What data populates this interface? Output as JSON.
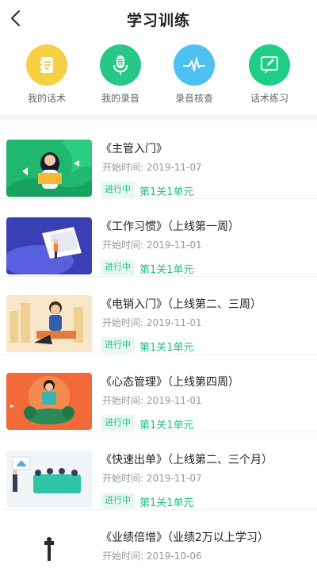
{
  "header": {
    "title": "学习训练"
  },
  "quick_nav": [
    {
      "label": "我的话术",
      "icon": "script-book-icon",
      "color": "#f7cf45"
    },
    {
      "label": "我的录音",
      "icon": "microphone-icon",
      "color": "#27c788"
    },
    {
      "label": "录音核查",
      "icon": "waveform-icon",
      "color": "#4ec1f2"
    },
    {
      "label": "话术练习",
      "icon": "edit-chat-icon",
      "color": "#1fcd85"
    }
  ],
  "courses": [
    {
      "title": "《主管入门》",
      "date": "开始时间: 2019-11-07",
      "status": "进行中",
      "progress": "第1关1单元"
    },
    {
      "title": "《工作习惯》（上线第一周）",
      "date": "开始时间: 2019-11-01",
      "status": "进行中",
      "progress": "第1关1单元"
    },
    {
      "title": "《电销入门》（上线第二、三周）",
      "date": "开始时间: 2019-11-01",
      "status": "进行中",
      "progress": "第1关1单元"
    },
    {
      "title": "《心态管理》（上线第四周）",
      "date": "开始时间: 2019-11-01",
      "status": "进行中",
      "progress": "第1关1单元"
    },
    {
      "title": "《快速出单》（上线第二、三个月）",
      "date": "开始时间: 2019-11-07",
      "status": "进行中",
      "progress": "第1关1单元"
    },
    {
      "title": "《业绩倍增》（业绩2万以上学习）",
      "date": "开始时间: 2019-10-06",
      "status": "",
      "progress": ""
    }
  ]
}
